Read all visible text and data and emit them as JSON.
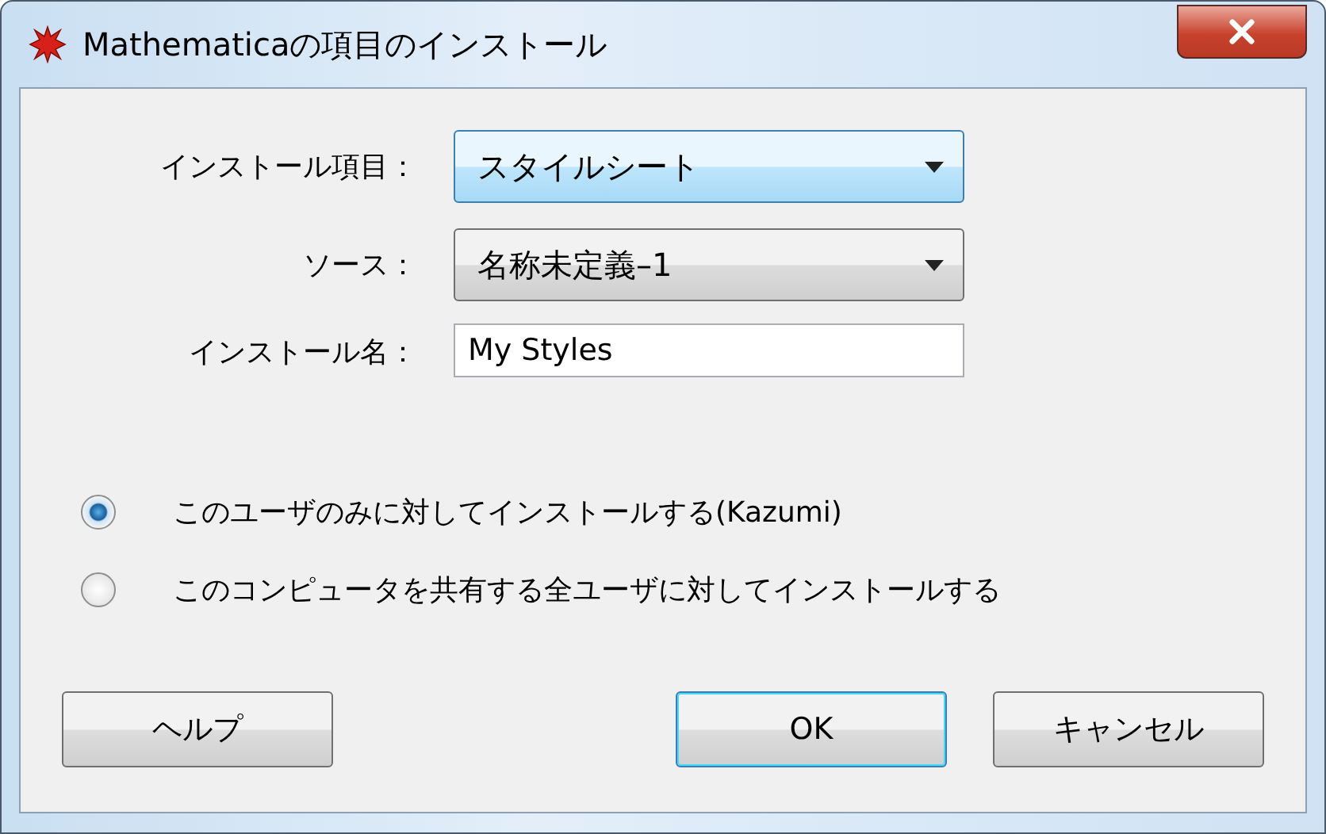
{
  "window": {
    "title": "Mathematicaの項目のインストール"
  },
  "fields": [
    {
      "kind": "dropdown",
      "label": "インストール項目：",
      "value": "スタイルシート",
      "focused": true
    },
    {
      "kind": "dropdown",
      "label": "ソース：",
      "value": "名称未定義–1",
      "focused": false
    },
    {
      "kind": "text",
      "label": "インストール名：",
      "value": "My Styles"
    }
  ],
  "scope": [
    {
      "label": "このユーザのみに対してインストールする(Kazumi)",
      "selected": true
    },
    {
      "label": "このコンピュータを共有する全ユーザに対してインストールする",
      "selected": false
    }
  ],
  "help_button": {
    "label": "ヘルプ",
    "default": false
  },
  "buttons": [
    {
      "label": "OK",
      "default": true
    },
    {
      "label": "キャンセル",
      "default": false
    }
  ]
}
